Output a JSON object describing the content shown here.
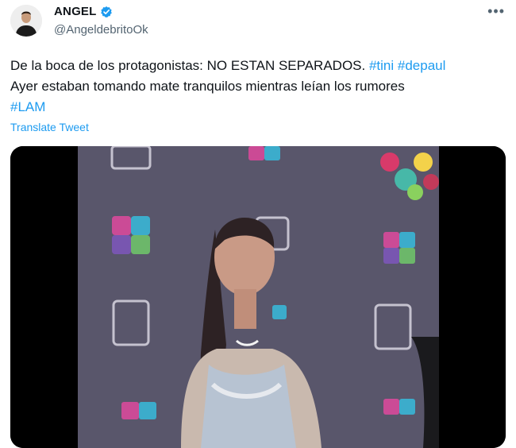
{
  "author": {
    "display_name": "ANGEL",
    "handle": "@AngeldebritoOk",
    "verified": true
  },
  "more_icon": "more-horizontal-icon",
  "tweet": {
    "line1_text": "De la boca de los protagonistas: NO ESTAN SEPARADOS. ",
    "hashtag_tini": "#tini",
    "hashtag_depaul": "#depaul",
    "line2_text": " Ayer estaban tomando mate tranquilos mientras leían  los rumores",
    "hashtag_lam": "#LAM"
  },
  "translate_label": "Translate Tweet",
  "colors": {
    "link": "#1d9bf0",
    "text": "#0f1419",
    "secondary": "#536471",
    "verified": "#1d9bf0"
  }
}
